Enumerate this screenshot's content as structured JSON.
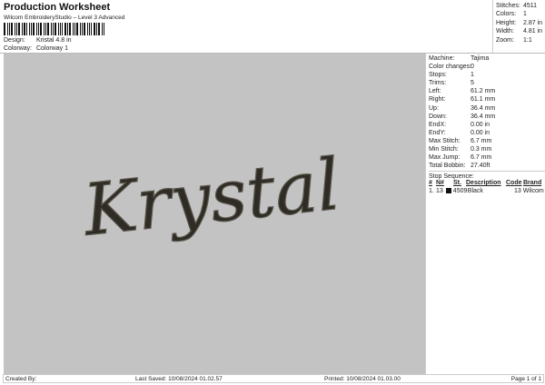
{
  "header": {
    "title": "Production Worksheet",
    "subtitle": "Wilcom EmbroideryStudio – Level 3 Advanced",
    "design_label": "Design:",
    "design_value": "Kristal 4.8 in",
    "colorway_label": "Colorway:",
    "colorway_value": "Colorway 1"
  },
  "stats": [
    {
      "k": "Stitches:",
      "v": "4511"
    },
    {
      "k": "Colors:",
      "v": "1"
    },
    {
      "k": "Height:",
      "v": "2.87 in"
    },
    {
      "k": "Width:",
      "v": "4.81 in"
    },
    {
      "k": "Zoom:",
      "v": "1:1"
    }
  ],
  "design_preview": {
    "text": "Krystal",
    "thread_color": "#2e2c25",
    "background": "#c3c3c3"
  },
  "machine": [
    {
      "k": "Machine:",
      "v": "Tajima"
    },
    {
      "k": "Color changes:",
      "v": "0"
    },
    {
      "k": "Stops:",
      "v": "1"
    },
    {
      "k": "Trims:",
      "v": "5"
    },
    {
      "k": "Left:",
      "v": "61.2 mm"
    },
    {
      "k": "Right:",
      "v": "61.1 mm"
    },
    {
      "k": "Up:",
      "v": "36.4 mm"
    },
    {
      "k": "Down:",
      "v": "36.4 mm"
    },
    {
      "k": "EndX:",
      "v": "0.00 in"
    },
    {
      "k": "EndY:",
      "v": "0.00 in"
    },
    {
      "k": "Max Stitch:",
      "v": "6.7 mm"
    },
    {
      "k": "Min Stitch:",
      "v": "0.3 mm"
    },
    {
      "k": "Max Jump:",
      "v": "6.7 mm"
    },
    {
      "k": "Total Bobbin:",
      "v": "27.40ft"
    }
  ],
  "stop_sequence": {
    "title": "Stop Sequence:",
    "columns": [
      "#",
      "N#",
      "St.",
      "Description",
      "Code",
      "Brand"
    ],
    "rows": [
      {
        "num": "1.",
        "n": "13",
        "color": "#111111",
        "st": "4509",
        "desc": "Black",
        "code": "13",
        "brand": "Wilcom"
      }
    ]
  },
  "footer": {
    "created": "Created By:",
    "saved": "Last Saved: 10/08/2024 01.02.57",
    "printed": "Printed: 10/08/2024 01.03.00",
    "page": "Page 1 of 1"
  }
}
